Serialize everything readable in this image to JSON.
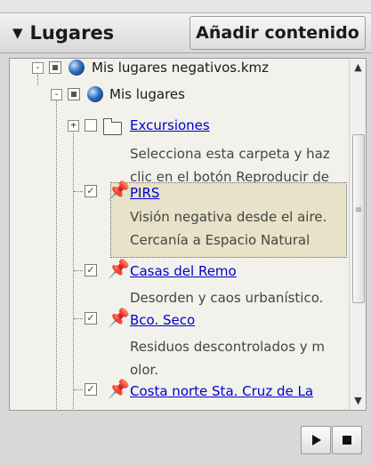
{
  "header": {
    "title": "Lugares",
    "add_button_label": "Añadir contenido"
  },
  "tree": {
    "root": {
      "label": "Mis lugares negativos.kmz",
      "expander": "-"
    },
    "child": {
      "label": "Mis lugares",
      "expander": "-"
    },
    "items": [
      {
        "label": "Excursiones",
        "checked": false,
        "icon": "folder-icon",
        "expander": "+",
        "description_lines": [
          "Selecciona esta carpeta y haz",
          "clic en el botón Reproducir de"
        ]
      },
      {
        "label": "PIRS",
        "checked": true,
        "icon": "pushpin-icon",
        "selected": true,
        "description_lines": [
          "Visión negativa desde el aire.",
          "Cercanía a Espacio Natural"
        ]
      },
      {
        "label": "Casas del Remo",
        "checked": true,
        "icon": "pushpin-icon",
        "description_lines": [
          "Desorden y caos urbanístico."
        ]
      },
      {
        "label": "Bco. Seco",
        "checked": true,
        "icon": "pushpin-icon",
        "description_lines": [
          "Residuos descontrolados y m",
          "olor."
        ]
      },
      {
        "label": "Costa norte Sta. Cruz de La",
        "checked": true,
        "icon": "pushpin-icon",
        "description_lines": []
      }
    ]
  },
  "controls": {
    "play_icon": "play-icon",
    "stop_icon": "stop-icon"
  },
  "colors": {
    "link": "#0000cc",
    "selection": "#e7e2c8",
    "pin": "#e0b900"
  }
}
